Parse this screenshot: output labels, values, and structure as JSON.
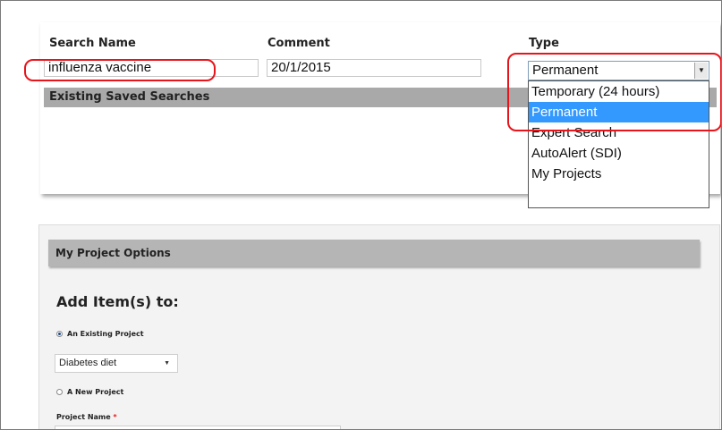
{
  "saved_search": {
    "headers": {
      "search_name": "Search Name",
      "comment": "Comment",
      "type": "Type"
    },
    "search_name_value": "influenza vaccine",
    "comment_value": "20/1/2015",
    "type_select": {
      "selected": "Permanent",
      "options": [
        "Temporary (24 hours)",
        "Permanent",
        "Expert Search",
        "AutoAlert (SDI)",
        "My Projects"
      ],
      "highlighted_index": 1
    },
    "existing_label": "Existing Saved Searches"
  },
  "project_options": {
    "bar_title": "My Project Options",
    "add_title": "Add Item(s) to:",
    "existing_radio_label": "An Existing Project",
    "existing_radio_checked": true,
    "project_select_value": "Diabetes diet",
    "new_radio_label": "A New Project",
    "new_radio_checked": false,
    "project_name_label": "Project Name",
    "required_mark": "*"
  },
  "annotation_color": "#e8141b",
  "highlight_color": "#3399ff"
}
